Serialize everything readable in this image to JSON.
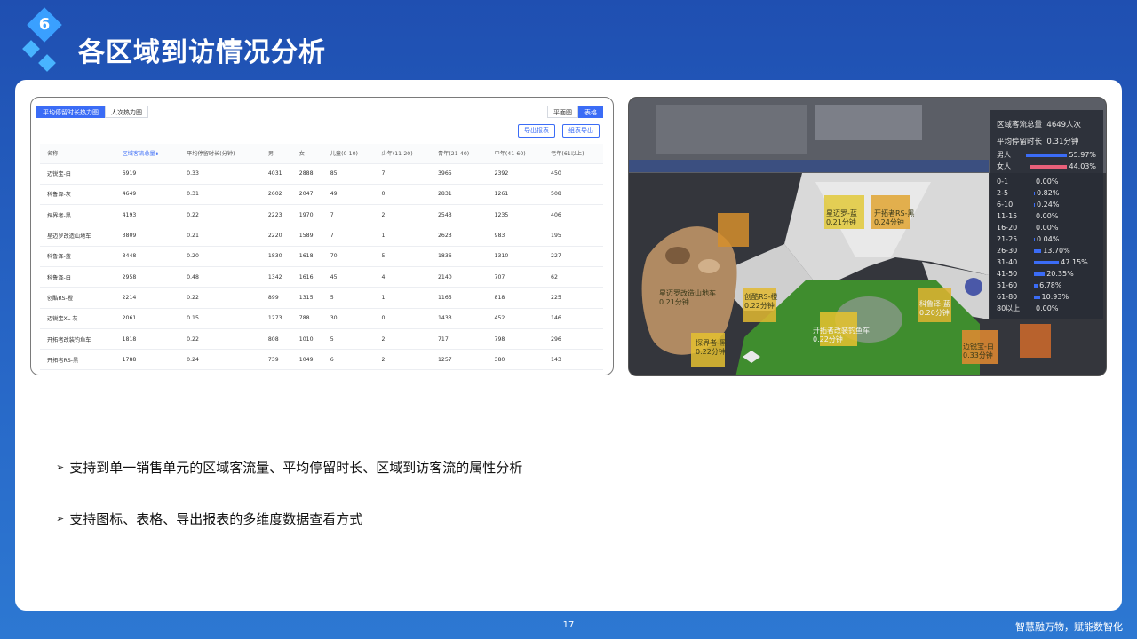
{
  "header": {
    "section_number": "6",
    "title": "各区域到访情况分析"
  },
  "table_panel": {
    "tabs": [
      "平均停留时长热力图",
      "人次热力图"
    ],
    "view_toggle": [
      "平面图",
      "表格"
    ],
    "export_buttons": [
      "导出报表",
      "组表导出"
    ],
    "columns": [
      "名称",
      "区域客流总量",
      "平均停留时长(分钟)",
      "男",
      "女",
      "儿童(0-10)",
      "少年(11-20)",
      "青年(21-40)",
      "中年(41-60)",
      "老年(61以上)"
    ],
    "sort_indicator": "⬍",
    "rows": [
      [
        "迈锐宝-白",
        "6919",
        "0.33",
        "4031",
        "2888",
        "85",
        "7",
        "3965",
        "2392",
        "450"
      ],
      [
        "科鲁泽-灰",
        "4649",
        "0.31",
        "2602",
        "2047",
        "49",
        "0",
        "2831",
        "1261",
        "508"
      ],
      [
        "探界者-黑",
        "4193",
        "0.22",
        "2223",
        "1970",
        "7",
        "2",
        "2543",
        "1235",
        "406"
      ],
      [
        "星迈罗改造山地车",
        "3809",
        "0.21",
        "2220",
        "1589",
        "7",
        "1",
        "2623",
        "983",
        "195"
      ],
      [
        "科鲁泽-蓝",
        "3448",
        "0.20",
        "1830",
        "1618",
        "70",
        "5",
        "1836",
        "1310",
        "227"
      ],
      [
        "科鲁泽-白",
        "2958",
        "0.48",
        "1342",
        "1616",
        "45",
        "4",
        "2140",
        "707",
        "62"
      ],
      [
        "创酷RS-橙",
        "2214",
        "0.22",
        "899",
        "1315",
        "5",
        "1",
        "1165",
        "818",
        "225"
      ],
      [
        "迈锐宝XL-灰",
        "2061",
        "0.15",
        "1273",
        "788",
        "30",
        "0",
        "1433",
        "452",
        "146"
      ],
      [
        "开拓者改装钓鱼车",
        "1818",
        "0.22",
        "808",
        "1010",
        "5",
        "2",
        "717",
        "798",
        "296"
      ],
      [
        "开拓者RS-黑",
        "1788",
        "0.24",
        "739",
        "1049",
        "6",
        "2",
        "1257",
        "380",
        "143"
      ]
    ]
  },
  "map_panel": {
    "zones": [
      {
        "name": "星迈罗-蓝",
        "value": "0.21分钟"
      },
      {
        "name": "开拓者RS-黑",
        "value": "0.24分钟"
      },
      {
        "name": "星迈罗改造山地车",
        "value": "0.21分钟"
      },
      {
        "name": "创酷RS-橙",
        "value": "0.22分钟"
      },
      {
        "name": "开拓者改装钓鱼车",
        "value": "0.22分钟"
      },
      {
        "name": "科鲁泽-蓝",
        "value": "0.20分钟"
      },
      {
        "name": "探界者-黑",
        "value": "0.22分钟"
      },
      {
        "name": "迈锐宝-白",
        "value": "0.33分钟"
      }
    ],
    "stats": {
      "total_label": "区域客流总量",
      "total_value": "4649人次",
      "avg_label": "平均停留时长",
      "avg_value": "0.31分钟",
      "gender": [
        {
          "label": "男人",
          "value": "55.97%",
          "pct": 55.97,
          "color": "#3b6cf6"
        },
        {
          "label": "女人",
          "value": "44.03%",
          "pct": 44.03,
          "color": "#e8607a"
        }
      ],
      "ages": [
        {
          "label": "0-1",
          "value": "0.00%",
          "pct": 0.0
        },
        {
          "label": "2-5",
          "value": "0.82%",
          "pct": 0.82
        },
        {
          "label": "6-10",
          "value": "0.24%",
          "pct": 0.24
        },
        {
          "label": "11-15",
          "value": "0.00%",
          "pct": 0.0
        },
        {
          "label": "16-20",
          "value": "0.00%",
          "pct": 0.0
        },
        {
          "label": "21-25",
          "value": "0.04%",
          "pct": 0.04
        },
        {
          "label": "26-30",
          "value": "13.70%",
          "pct": 13.7
        },
        {
          "label": "31-40",
          "value": "47.15%",
          "pct": 47.15
        },
        {
          "label": "41-50",
          "value": "20.35%",
          "pct": 20.35
        },
        {
          "label": "51-60",
          "value": "6.78%",
          "pct": 6.78
        },
        {
          "label": "61-80",
          "value": "10.93%",
          "pct": 10.93
        },
        {
          "label": "80以上",
          "value": "0.00%",
          "pct": 0.0
        }
      ],
      "age_color": "#3b6cf6"
    }
  },
  "bullets": [
    "支持到单一销售单元的区域客流量、平均停留时长、区域到访客流的属性分析",
    "支持图标、表格、导出报表的多维度数据查看方式"
  ],
  "bullet_marker": "➢",
  "footer": {
    "page_number": "17",
    "slogan": "智慧融万物，赋能数智化"
  }
}
